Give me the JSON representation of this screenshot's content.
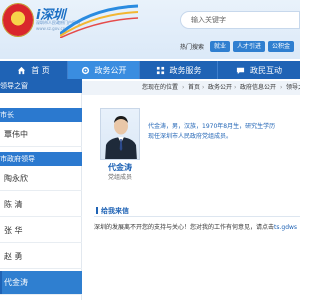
{
  "header": {
    "logo_name": "i深圳",
    "logo_sub": "深圳市人民政府门户网站",
    "logo_url": "www.sz.gov.cn",
    "search_placeholder": "输入关键字",
    "quicklinks_label": "热门搜索",
    "quicklinks": [
      "就业",
      "人才引进",
      "公积金"
    ]
  },
  "nav": {
    "items": [
      {
        "label": "首 页",
        "icon": "home-icon"
      },
      {
        "label": "政务公开",
        "icon": "gear-icon"
      },
      {
        "label": "政务服务",
        "icon": "grid-icon"
      },
      {
        "label": "政民互动",
        "icon": "chat-icon"
      }
    ],
    "active_index": 1
  },
  "sidebar": {
    "head": "领导之窗",
    "categories": [
      "市长",
      "市政府领导"
    ],
    "mayor": "覃伟中",
    "leaders": [
      "陶永欣",
      "陈 清",
      "张 华",
      "赵 勇",
      "代金涛"
    ],
    "active_leader_index": 4
  },
  "breadcrumb": [
    "您现在的位置",
    "首页",
    "政务公开",
    "政府信息公开",
    "领导之窗"
  ],
  "profile": {
    "name": "代金涛",
    "title": "党组成员",
    "bio_line1": "代金涛，男，汉族，1970年8月生，研究生学历",
    "bio_line2": "现任深圳市人民政府党组成员。"
  },
  "letter": {
    "title": "给我来信",
    "text": "深圳的发展离不开您的支持与关心！您对我的工作有何意见，请点击",
    "link": "ts.gdws"
  },
  "colors": {
    "nav_bg": "#1f63b5",
    "nav_active": "#3a8de0",
    "accent": "#2f7fd0"
  }
}
